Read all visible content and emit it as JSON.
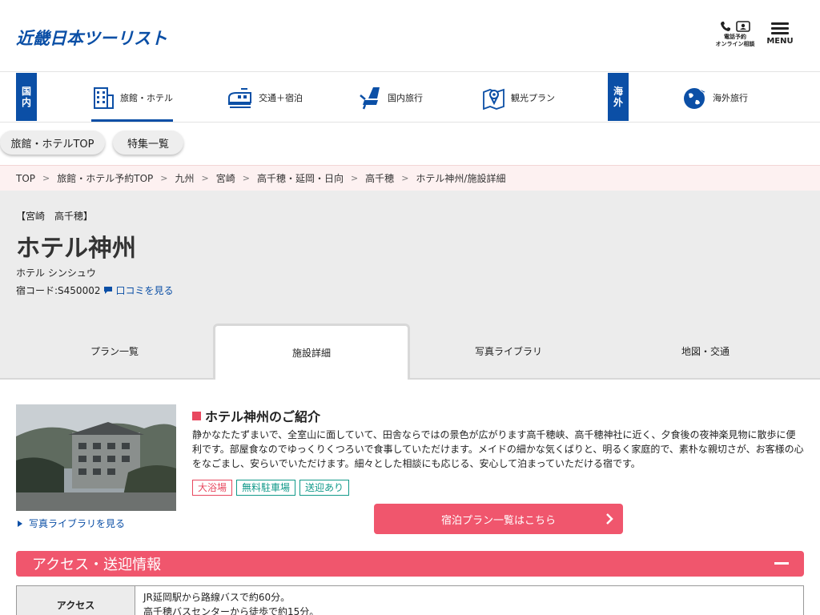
{
  "header": {
    "logo": "近畿日本ツーリスト",
    "phone_label_1": "電話予約",
    "phone_label_2": "オンライン相談",
    "menu_label": "MENU"
  },
  "category_nav": {
    "domestic_badge": [
      "国",
      "内"
    ],
    "overseas_badge": [
      "海",
      "外"
    ],
    "items": [
      {
        "label": "旅館・ホテル",
        "icon": "building-icon",
        "active": true
      },
      {
        "label": "交通＋宿泊",
        "icon": "train-icon"
      },
      {
        "label": "国内旅行",
        "icon": "seat-icon"
      },
      {
        "label": "観光プラン",
        "icon": "map-icon"
      },
      {
        "label": "海外旅行",
        "icon": "globe-plane-icon"
      }
    ]
  },
  "sub_nav": [
    "旅館・ホテルTOP",
    "特集一覧"
  ],
  "breadcrumb": [
    "TOP",
    "旅館・ホテル予約TOP",
    "九州",
    "宮崎",
    "高千穂・延岡・日向",
    "高千穂",
    "ホテル神州/施設詳細"
  ],
  "hotel": {
    "area": "【宮崎　高千穂】",
    "name": "ホテル神州",
    "kana": "ホテル シンシュウ",
    "code": "宿コード:S450002",
    "review_link": "口コミを見る"
  },
  "tabs": [
    {
      "label": "プラン一覧"
    },
    {
      "label": "施設詳細",
      "active": true
    },
    {
      "label": "写真ライブラリ"
    },
    {
      "label": "地図・交通"
    }
  ],
  "intro": {
    "photo_link": "写真ライブラリを見る",
    "title": "ホテル神州のご紹介",
    "text": "静かなたたずまいで、全室山に面していて、田舎ならではの景色が広がります高千穂峡、高千穂神社に近く、夕食後の夜神楽見物に散歩に便利です。部屋食なのでゆっくりくつろいで食事していただけます。メイドの細かな気くばりと、明るく家庭的で、素朴な親切さが、お客様の心をなごまし、安らいでいただけます。細々とした相談にも応じる、安心して泊まっていただける宿です。",
    "tags": [
      {
        "label": "大浴場",
        "color": "red"
      },
      {
        "label": "無料駐車場",
        "color": "green"
      },
      {
        "label": "送迎あり",
        "color": "green"
      }
    ],
    "cta": "宿泊プラン一覧はこちら"
  },
  "access": {
    "heading": "アクセス・送迎情報",
    "row_label": "アクセス",
    "lines": [
      "JR延岡駅から路線バスで約60分。",
      "高千穂バスセンターから徒歩で約15分。"
    ]
  },
  "colors": {
    "brand_blue": "#0b4fa6",
    "accent_pink": "#f0566d",
    "tag_green": "#129a8a"
  }
}
